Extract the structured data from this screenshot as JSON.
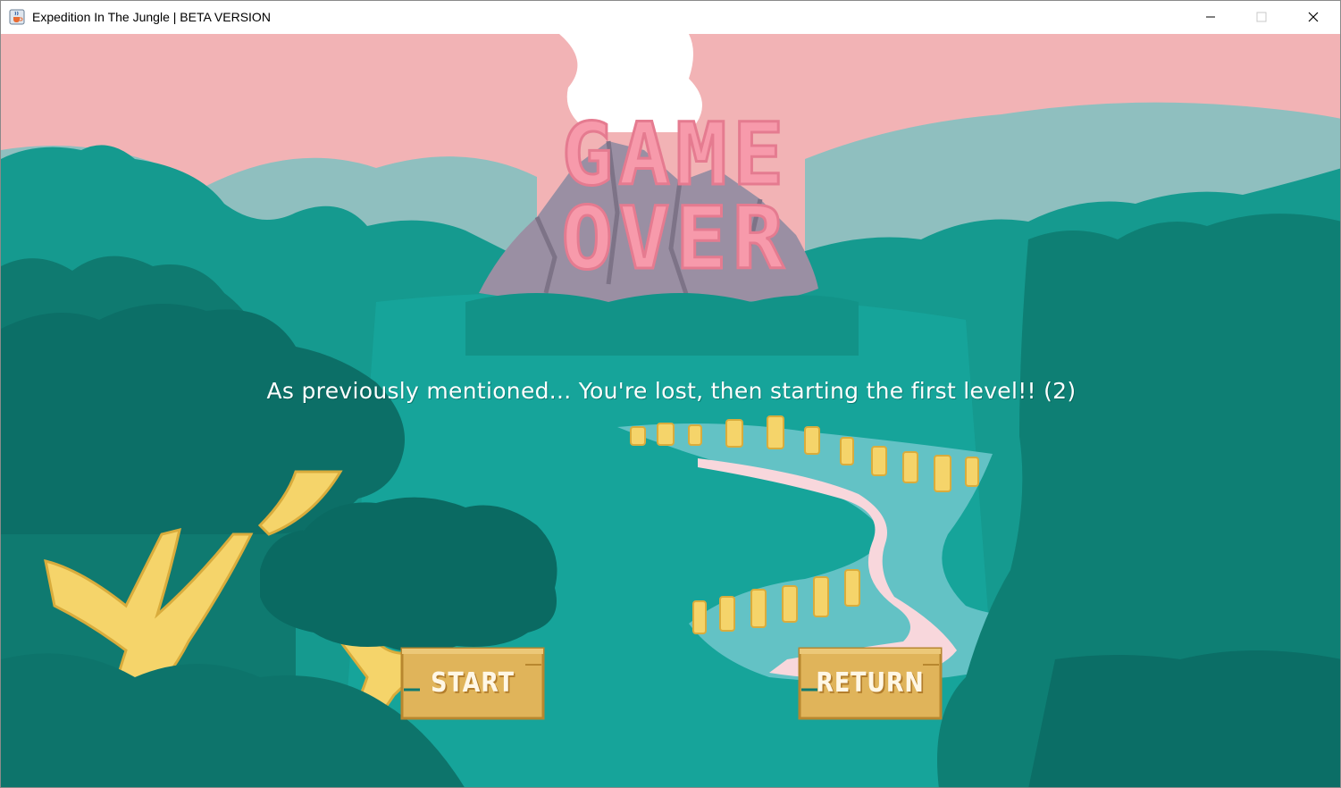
{
  "window": {
    "title": "Expedition In The Jungle | BETA VERSION",
    "icon": "java-cup-icon",
    "controls": [
      "minimize-icon",
      "maximize-icon",
      "close-icon"
    ]
  },
  "game": {
    "heading_line1": "GAME",
    "heading_line2": "OVER",
    "message": "As previously mentioned... You're lost, then starting the first level!! (2)",
    "buttons": {
      "start_label": "START",
      "return_label": "RETURN"
    }
  },
  "colors": {
    "sky": "#f2b3b5",
    "heading": "#f79aab",
    "jungle_dark": "#0c6f67",
    "jungle_mid": "#0f8a7f",
    "jungle_light": "#1aa097",
    "mountain": "#9a8fa3",
    "trunk": "#f5d46a",
    "path": "#f8d7dc",
    "sign": "#e0b45a"
  }
}
